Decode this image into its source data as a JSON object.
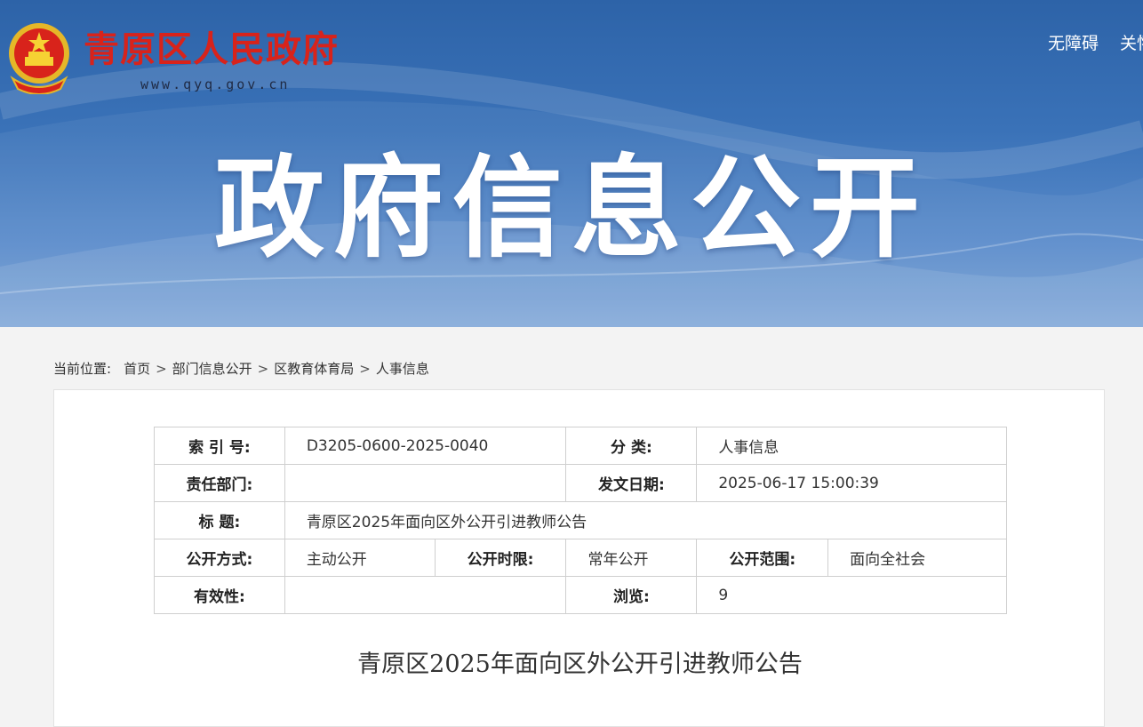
{
  "header": {
    "site_name": "青原区人民政府",
    "site_url": "www.qyq.gov.cn",
    "links": [
      "无障碍",
      "关怀"
    ],
    "banner_title": "政府信息公开"
  },
  "breadcrumb": {
    "label": "当前位置:",
    "items": [
      "首页",
      "部门信息公开",
      "区教育体育局",
      "人事信息"
    ],
    "separator": ">"
  },
  "meta": {
    "index_key": "索 引 号:",
    "index_val": "D3205-0600-2025-0040",
    "category_key": "分 类:",
    "category_val": "人事信息",
    "dept_key": "责任部门:",
    "dept_val": "",
    "date_key": "发文日期:",
    "date_val": "2025-06-17 15:00:39",
    "title_key": "标 题:",
    "title_val": "青原区2025年面向区外公开引进教师公告",
    "method_key": "公开方式:",
    "method_val": "主动公开",
    "limit_key": "公开时限:",
    "limit_val": "常年公开",
    "scope_key": "公开范围:",
    "scope_val": "面向全社会",
    "validity_key": "有效性:",
    "validity_val": "",
    "views_key": "浏览:",
    "views_val": "9"
  },
  "article": {
    "title": "青原区2025年面向区外公开引进教师公告"
  },
  "colors": {
    "brand_red": "#d8231b",
    "banner_blue": "#2d63a8"
  }
}
